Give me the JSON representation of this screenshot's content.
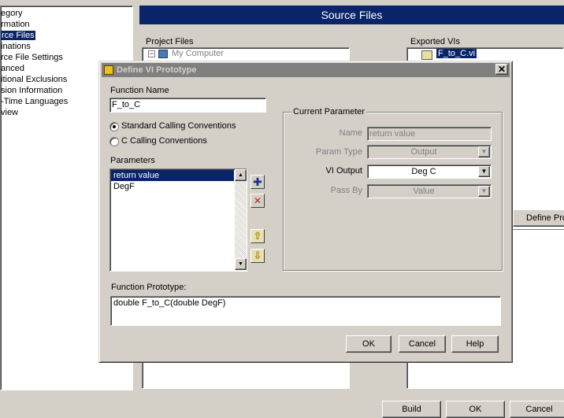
{
  "background": {
    "category_items": [
      "egory",
      "rmation",
      "rce Files",
      "inations",
      "rce File Settings",
      "anced",
      "itional Exclusions",
      "sion Information",
      "-Time Languages",
      "view"
    ],
    "selected_category_index": 2,
    "header_title": "Source Files",
    "project_files_label": "Project Files",
    "tree_root": "My Computer",
    "exported_vis_label": "Exported VIs",
    "exported_item": "F_to_C.vi",
    "define_proto_fragment": "Define Pro",
    "buttons": {
      "build": "Build",
      "ok": "OK",
      "cancel": "Cancel"
    }
  },
  "dialog": {
    "title": "Define VI Prototype",
    "close_glyph": "✕",
    "function_name_label": "Function Name",
    "function_name_value": "F_to_C",
    "conventions": [
      {
        "label": "Standard Calling Conventions",
        "checked": true
      },
      {
        "label": "C Calling Conventions",
        "checked": false
      }
    ],
    "parameters_label": "Parameters",
    "parameters": [
      "return value",
      "DegF"
    ],
    "selected_parameter_index": 0,
    "side_buttons": {
      "add_glyph": "✚",
      "remove_glyph": "✕",
      "up_glyph": "⇧",
      "down_glyph": "⇩"
    },
    "current_parameter": {
      "group_label": "Current Parameter",
      "name_label": "Name",
      "name_value": "return value",
      "param_type_label": "Param Type",
      "param_type_value": "Output",
      "vi_output_label": "VI Output",
      "vi_output_value": "Deg C",
      "pass_by_label": "Pass By",
      "pass_by_value": "Value"
    },
    "function_prototype_label": "Function Prototype:",
    "function_prototype_value": "double F_to_C(double DegF)",
    "buttons": {
      "ok": "OK",
      "cancel": "Cancel",
      "help": "Help"
    },
    "combo_arrow_glyph": "▼"
  }
}
